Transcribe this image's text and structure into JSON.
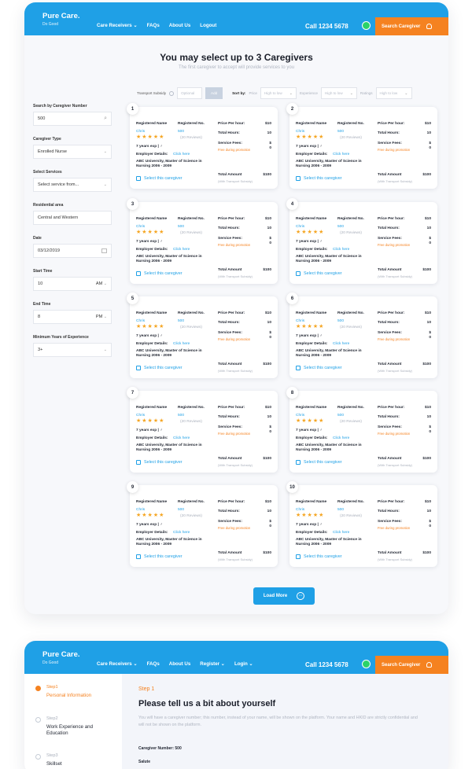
{
  "brand": {
    "name": "Pure Care.",
    "tagline": "Do Good"
  },
  "nav1": {
    "items": [
      "Care Receivers ⌄",
      "FAQs",
      "About Us",
      "Logout"
    ],
    "call": "Call 1234 5678",
    "search_caregiver": "Search Caregiver"
  },
  "nav2": {
    "items": [
      "Care Receivers ⌄",
      "FAQs",
      "About Us",
      "Register ⌄",
      "Login ⌄"
    ],
    "call": "Call 1234 5678",
    "search_caregiver": "Search Caregiver"
  },
  "page": {
    "title": "You may select up to 3 Caregivers",
    "subtitle": "The first caregiver to accept will provide services to you"
  },
  "filters": {
    "transport_label": "Transport Subsidy",
    "optional_placeholder": "Optional",
    "add": "Add",
    "sort_label": "Sort by:",
    "price_label": "Price",
    "price_value": "High to low",
    "experience_label": "Experience",
    "experience_value": "High to low",
    "ratings_label": "Ratings",
    "ratings_value": "High to low"
  },
  "sidebar": {
    "caregiver_number_label": "Search by Caregiver Number",
    "caregiver_number_value": "500",
    "caregiver_type_label": "Caregiver Type",
    "caregiver_type_value": "Enrolled Nurse",
    "services_label": "Select Services",
    "services_value": "Select service from...",
    "area_label": "Residential area",
    "area_value": "Central and Western",
    "date_label": "Date",
    "date_value": "03/12/2019",
    "start_label": "Start Time",
    "start_value": "10",
    "start_ampm": "AM",
    "end_label": "End Time",
    "end_value": "8",
    "end_ampm": "PM",
    "exp_label": "Minimum Years of Experience",
    "exp_value": "3+"
  },
  "card_labels": {
    "registered_name": "Registered Name",
    "registered_no": "Registered No.",
    "price_per_hour": "Price Per hour:",
    "total_hours": "Total Hours:",
    "service_fees": "Service Fees:",
    "free_promo": "Free during promotion",
    "reviews": "(20 Reviews)",
    "exp": "7 years exp  |  ♂",
    "employer": "Employer Details:",
    "click_here": "Click here",
    "education": "ABC University, Master of Science in Nursing 2006 - 2009",
    "total_amount": "Total Amount",
    "with_subsidy": "(With Transport Subsidy)",
    "select": "Select this caregiver",
    "name": "Chris",
    "number": "500",
    "price": "$10",
    "hours": "10",
    "fees_symbol": "$",
    "fees_value": "0",
    "amount": "$100"
  },
  "cards": [
    "1",
    "2",
    "3",
    "4",
    "5",
    "6",
    "7",
    "8",
    "9",
    "10"
  ],
  "load_more": "Load More",
  "form": {
    "steps": [
      {
        "title": "Step1",
        "name": "Personal Information"
      },
      {
        "title": "Step2",
        "name": "Work Experience and Education"
      },
      {
        "title": "Step3",
        "name": "Skillset"
      }
    ],
    "step_label": "Step 1",
    "heading": "Please tell us a bit about yourself",
    "description": "You will have a caregiver number; this number, instead of your name, will be shown on the platform. Your name and HKID are strictly confidential and will not be shown on the platform.",
    "caregiver_number": "Caregiver Number: 500",
    "salute": "Salute"
  },
  "colors": {
    "primary": "#1fa0e6",
    "accent": "#f58220",
    "star": "#f5a623"
  }
}
